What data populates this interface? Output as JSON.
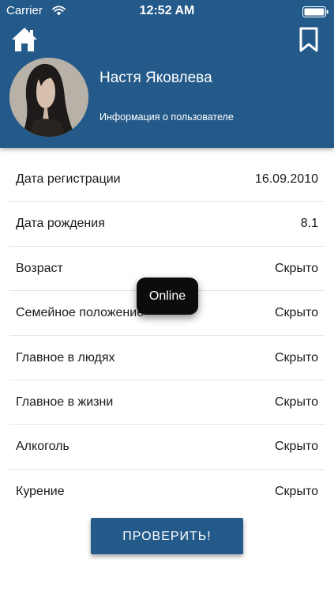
{
  "status_bar": {
    "carrier": "Carrier",
    "time": "12:52 AM"
  },
  "header": {
    "home_icon": "home-icon",
    "bookmark_icon": "bookmark-icon",
    "user_name": "Настя Яковлева",
    "subtitle": "Информация о пользователе",
    "color": "#245a8a"
  },
  "info_rows": [
    {
      "label": "Дата регистрации",
      "value": "16.09.2010"
    },
    {
      "label": "Дата рождения",
      "value": "8.1"
    },
    {
      "label": "Возраст",
      "value": "Скрыто"
    },
    {
      "label": "Семейное положение",
      "value": "Скрыто"
    },
    {
      "label": "Главное в людях",
      "value": "Скрыто"
    },
    {
      "label": "Главное в жизни",
      "value": "Скрыто"
    },
    {
      "label": "Алкоголь",
      "value": "Скрыто"
    },
    {
      "label": "Курение",
      "value": "Скрыто"
    }
  ],
  "toast": {
    "text": "Online"
  },
  "action_button": {
    "label": "ПРОВЕРИТЬ!"
  }
}
